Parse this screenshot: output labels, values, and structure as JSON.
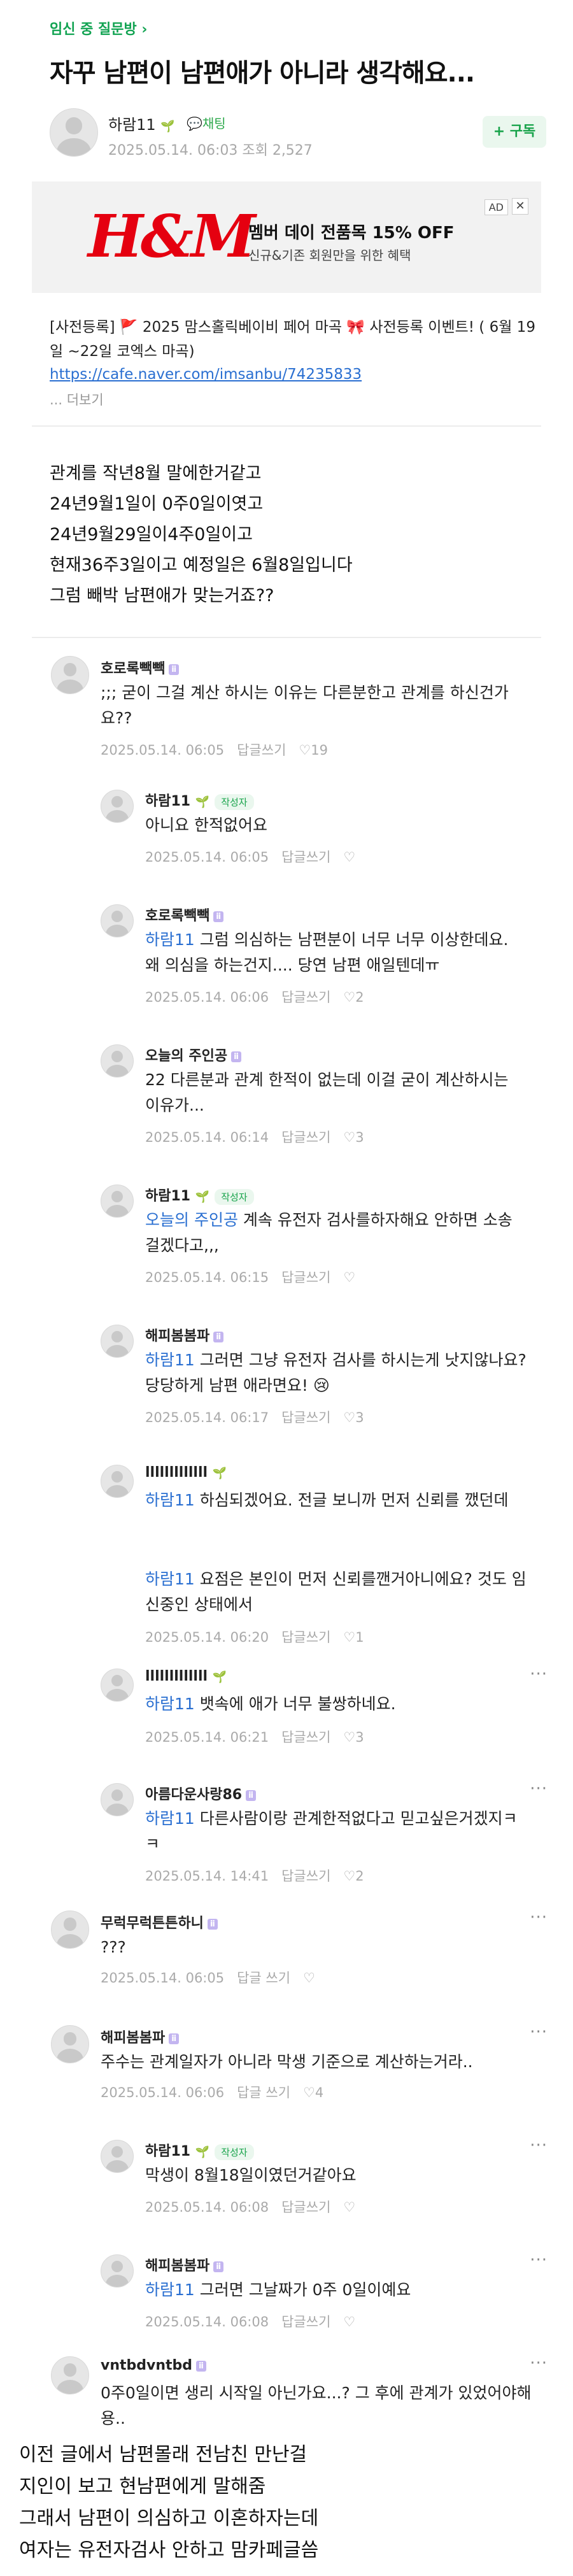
{
  "category": "임신 중 질문방 ›",
  "title": "자꾸 남편이 남편애가 아니라 생각해요...",
  "author": {
    "name": "하람11",
    "chat": "채팅",
    "meta": "2025.05.14. 06:03 조회 2,527"
  },
  "subscribe": "+ 구독",
  "ad": {
    "logo": "H&M",
    "title": "멤버 데이 전품목 15% OFF",
    "subtitle": "신규&기존 회원만을 위한 혜택",
    "badge": "AD",
    "close": "✕"
  },
  "notice": {
    "text": "[사전등록] 🚩 2025 맘스홀릭베이비 페어 마곡 🎀 사전등록 이벤트! ( 6월 19일 ~22일 코엑스 마곡)",
    "link": "https://cafe.naver.com/imsanbu/74235833",
    "more": "... 더보기"
  },
  "body": [
    "관계를 작년8월 말에한거같고",
    "24년9월1일이 0주0일이엿고",
    "24년9월29일이4주0일이고",
    "현재36주3일이고 예정일은 6월8일입니다",
    "그럼 빼박 남편애가 맞는거죠??"
  ],
  "comments": [
    {
      "name": "호로록빽빽",
      "badge": "ⅱ",
      "text": ";;; 굳이 그걸 계산 하시는 이유는 다른분한고 관계를 하신건가요??",
      "date": "2025.05.14. 06:05",
      "reply": "답글쓰기",
      "likes": "♡19"
    },
    {
      "name": "하람11",
      "author": "작성자",
      "text": "아니요 한적없어요",
      "date": "2025.05.14. 06:05",
      "reply": "답글쓰기",
      "likes": "♡"
    },
    {
      "name": "호로록빽빽",
      "badge": "ⅱ",
      "mention": "하람11",
      "text": " 그럼 의심하는 남편분이 너무 너무 이상한데요. 왜 의심을 하는건지.... 당연 남편 애일텐데ㅠ",
      "date": "2025.05.14. 06:06",
      "reply": "답글쓰기",
      "likes": "♡2"
    },
    {
      "name": "오늘의 주인공",
      "badge": "ⅱ",
      "text": "22 다른분과 관계 한적이 없는데 이걸 굳이 계산하시는 이유가...",
      "date": "2025.05.14. 06:14",
      "reply": "답글쓰기",
      "likes": "♡3"
    },
    {
      "name": "하람11",
      "author": "작성자",
      "mention": "오늘의 주인공",
      "text": " 계속 유전자 검사를하자해요 안하면 소송 걸겠다고,,,",
      "date": "2025.05.14. 06:15",
      "reply": "답글쓰기",
      "likes": "♡"
    },
    {
      "name": "해피봄봄파",
      "badge": "ⅱ",
      "mention": "하람11",
      "text": " 그러면 그냥 유전자 검사를 하시는게 낫지않나요? 당당하게 남편 애라면요! 😢",
      "date": "2025.05.14. 06:17",
      "reply": "답글쓰기",
      "likes": "♡3"
    },
    {
      "name": "lllllllllllll",
      "mention": "하람11",
      "text": " 하심되겠어요. 전글 보니까 먼저 신뢰를 깼던데",
      "text2_mention": "하람11",
      "text2": " 요점은 본인이 먼저 신뢰를깬거아니에요? 것도 임신중인 상태에서",
      "date": "2025.05.14. 06:20",
      "reply": "답글쓰기",
      "likes": "♡1"
    },
    {
      "name": "lllllllllllll",
      "mention": "하람11",
      "text": " 뱃속에 애가 너무 불쌍하네요.",
      "date": "2025.05.14. 06:21",
      "reply": "답글쓰기",
      "likes": "♡3"
    },
    {
      "name": "아름다운사랑86",
      "badge": "ⅱ",
      "mention": "하람11",
      "text": " 다른사람이랑 관계한적없다고 믿고싶은거겠지ㅋㅋ",
      "date": "2025.05.14. 14:41",
      "reply": "답글쓰기",
      "likes": "♡2"
    },
    {
      "name": "무럭무럭튼튼하니",
      "badge": "ⅱ",
      "text": "???",
      "date": "2025.05.14. 06:05",
      "reply": "답글 쓰기",
      "likes": "♡"
    },
    {
      "name": "해피봄봄파",
      "badge": "ⅱ",
      "text": "주수는 관계일자가 아니라 막생 기준으로 계산하는거라..",
      "date": "2025.05.14. 06:06",
      "reply": "답글 쓰기",
      "likes": "♡4"
    },
    {
      "name": "하람11",
      "author": "작성자",
      "text": "막생이 8월18일이였던거같아요",
      "date": "2025.05.14. 06:08",
      "reply": "답글쓰기",
      "likes": "♡"
    },
    {
      "name": "해피봄봄파",
      "badge": "ⅱ",
      "mention": "하람11",
      "text": " 그러면 그날짜가 0주 0일이예요",
      "date": "2025.05.14. 06:08",
      "reply": "답글쓰기",
      "likes": "♡"
    },
    {
      "name": "vntbdvntbd",
      "badge": "ⅱ",
      "text": "0주0일이면 생리 시작일 아닌가요...? 그 후에 관계가 있었어야해용..",
      "date": "",
      "reply": "",
      "likes": ""
    }
  ],
  "kebab": "···",
  "caption": [
    "이전 글에서 남편몰래 전남친 만난걸",
    "지인이 보고 현남편에게 말해줌",
    "그래서 남편이 의심하고 이혼하자는데",
    "여자는 유전자검사 안하고 맘카페글씀"
  ],
  "colors": {
    "green": "#12a352",
    "mention": "#2a6fd1",
    "hm_red": "#e50010"
  }
}
